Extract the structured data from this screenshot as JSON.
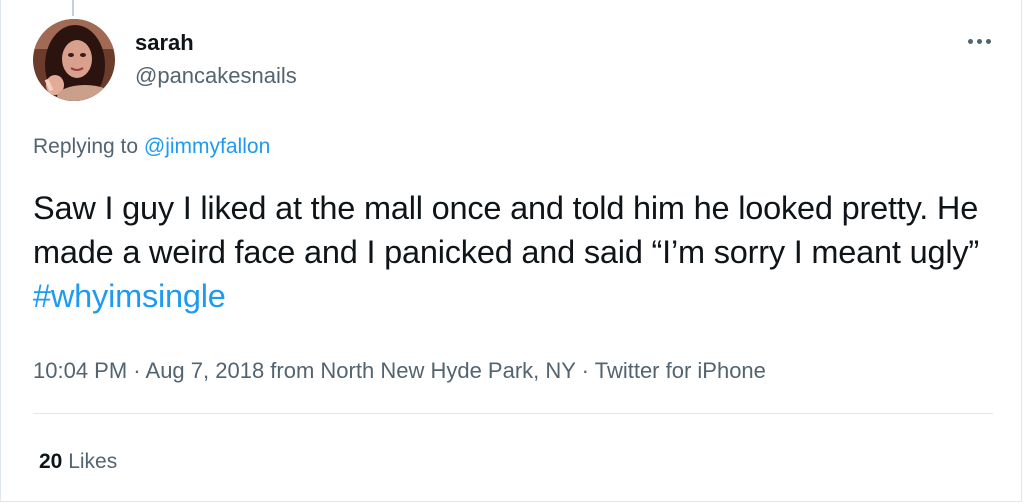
{
  "tweet": {
    "author": {
      "display_name": "sarah",
      "handle": "@pancakesnails",
      "avatar_icon": "profile-photo"
    },
    "more_icon": "ellipsis-icon",
    "replying_prefix": "Replying to",
    "replying_to": "@jimmyfallon",
    "text": "Saw I guy I liked at the mall once and told him he looked pretty. He made a weird face and I panicked and said “I’m sorry I meant ugly”",
    "hashtag": "#whyimsingle",
    "time": "10:04 PM",
    "separator_1": " · ",
    "date": "Aug 7, 2018",
    "location_prefix": " from ",
    "location": "North New Hyde Park, NY",
    "separator_2": " · ",
    "source": "Twitter for iPhone",
    "likes_count": "20",
    "likes_label": "Likes"
  },
  "colors": {
    "text": "#0f1419",
    "secondary": "#536471",
    "link": "#1d9bf0",
    "divider": "#e1e8ed"
  }
}
